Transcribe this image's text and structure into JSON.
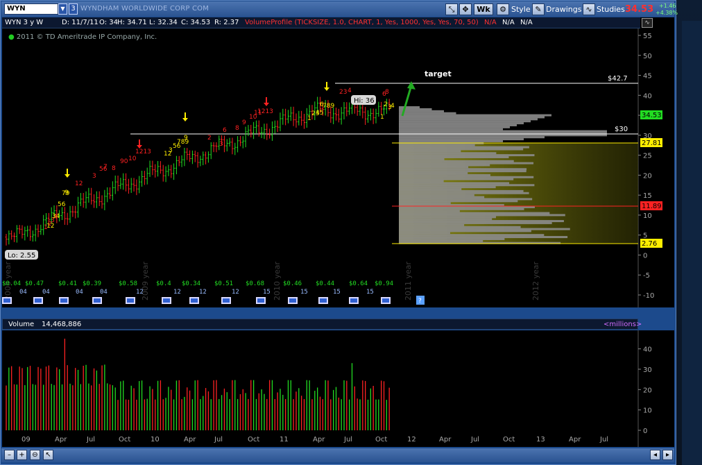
{
  "toolbar": {
    "symbol": "WYN",
    "link_number": "3",
    "company_name": "WYNDHAM WORLDWIDE CORP COM",
    "period_button": "Wk",
    "style_label": "Style",
    "drawings_label": "Drawings",
    "studies_label": "Studies",
    "last_price": "34.53",
    "change": "+1.46",
    "change_pct": "+4.38%"
  },
  "studybar": {
    "name": "WYN 3 y W",
    "date": "D: 11/7/11",
    "open": "O: 34",
    "high": "H: 34.71",
    "low": "L: 32.34",
    "close": "C: 34.53",
    "range": "R: 2.37",
    "volume_profile": "VolumeProfile (TICKSIZE, 1.0, CHART, 1, Yes, 1000, Yes, Yes, 70, 50)",
    "na1": "N/A",
    "na2": "N/A",
    "na3": "N/A"
  },
  "copyright": "2011 © TD Ameritrade IP Company, Inc.",
  "annotations": {
    "target": "target",
    "level_427": "$42.7",
    "level_30": "$30",
    "hi": "Hi: 36",
    "lo": "Lo: 2.55"
  },
  "price_axis": {
    "ticks": [
      "55",
      "50",
      "45",
      "40",
      "35",
      "30",
      "25",
      "20",
      "15",
      "10",
      "5",
      "0",
      "-5",
      "-10"
    ],
    "last_marker": "34.53",
    "marker_2781": "27.81",
    "marker_1189": "11.89",
    "marker_276": "2.76"
  },
  "dividends": [
    "0.04",
    "0.47",
    "0.41",
    "0.39",
    "0.58",
    "0.4",
    "0.34",
    "0.51",
    "0.68",
    "0.46",
    "0.44",
    "0.64",
    "0.94"
  ],
  "div_sub": [
    "04",
    "04",
    "04",
    "04",
    "12",
    "12",
    "12",
    "12",
    "15",
    "15",
    "15",
    "15"
  ],
  "year_watermarks": [
    "2008 year",
    "2009 year",
    "2010 year",
    "2011 year",
    "2012 year"
  ],
  "volume": {
    "label": "Volume",
    "value": "14,468,886",
    "units": "<millions>",
    "ticks": [
      "40",
      "30",
      "20",
      "10",
      "0"
    ]
  },
  "time_axis": [
    "09",
    "Apr",
    "Jul",
    "Oct",
    "10",
    "Apr",
    "Jul",
    "Oct",
    "11",
    "Apr",
    "Jul",
    "Oct",
    "12",
    "Apr",
    "Jul",
    "Oct",
    "13",
    "Apr",
    "Jul"
  ],
  "colors": {
    "up": "#22dd22",
    "down": "#ff2222",
    "setup_yellow": "#ffee00",
    "profile_gray": "#8c8c8c",
    "value_area": "#9a9a10",
    "price_red": "#ff3030"
  }
}
